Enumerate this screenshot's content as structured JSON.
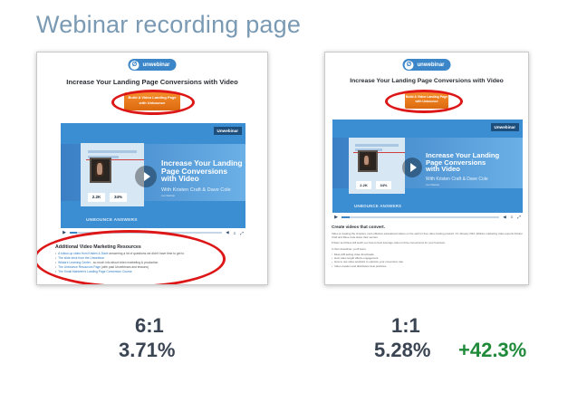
{
  "page": {
    "title": "Webinar recording page"
  },
  "colors": {
    "title": "#7a9ab4",
    "highlight": "#dd1717",
    "positive": "#1f8a3a",
    "stat_text": "#3a4452",
    "cta": "#e8781c"
  },
  "variant_a": {
    "logo": "unwebinar",
    "headline": "Increase Your Landing Page Conversions with Video",
    "cta_label": "Build A Video Landing Page\nwith Unbounce",
    "video": {
      "brand_tag": "Unwebinar",
      "title": "Increase Your Landing\nPage Conversions\nwith Video",
      "subtitle": "With Kristen Craft & Dave Cole",
      "date": "Live Webinar",
      "stat_1": "2.2K",
      "stat_2": "34%",
      "footer_brand": "UNBOUNCE ANSWERS"
    },
    "resources": {
      "heading": "Additional Video Marketing Resources",
      "items": [
        {
          "link": "A follow-up video from Kristen & Dave",
          "text": " answering a lot of questions we didn't have time to get to"
        },
        {
          "link": "The slide deck from the Unwebinar",
          "text": ""
        },
        {
          "link": "Wistia's Learning Center",
          "text": " - so much info about video marketing & production"
        },
        {
          "link": "The Unbounce Resources Page",
          "text": " (with past Unwebinars and lessons)"
        },
        {
          "link": "The Small Marketer's Landing Page Conversion Course",
          "text": ""
        }
      ]
    },
    "ratio": "6:1",
    "conversion_rate": "3.71%"
  },
  "variant_b": {
    "logo": "unwebinar",
    "headline": "Increase Your Landing Page Conversions with Video",
    "cta_label": "Build A Video Landing Page\nwith Unbounce",
    "video": {
      "brand_tag": "Unwebinar",
      "title": "Increase Your Landing\nPage Conversions\nwith Video",
      "subtitle": "With Kristen Craft & Dave Cole",
      "date": "Live Webinar",
      "stat_1": "2.2K",
      "stat_2": "34%",
      "footer_brand": "UNBOUNCE ANSWERS"
    },
    "body": {
      "heading": "Create videos that convert.",
      "paragraphs": [
        "Video is creating the simplest, most effective educational videos on the web for free video hosting product. On January 23rd, Wistia's marketing video experts Kristen Craft and Dave Cole share their secrets.",
        "Kristen and Dave will teach you how to best leverage video to drive conversions for your business.",
        "In this Unwebinar, you'll learn:"
      ],
      "bullets": [
        "Must-A/B testing video thumbnails",
        "How video length affects engagement",
        "How to use video analytics to optimize your conversion rate",
        "Video creation and distribution best practices"
      ]
    },
    "ratio": "1:1",
    "conversion_rate": "5.28%",
    "lift": "+42.3%"
  }
}
